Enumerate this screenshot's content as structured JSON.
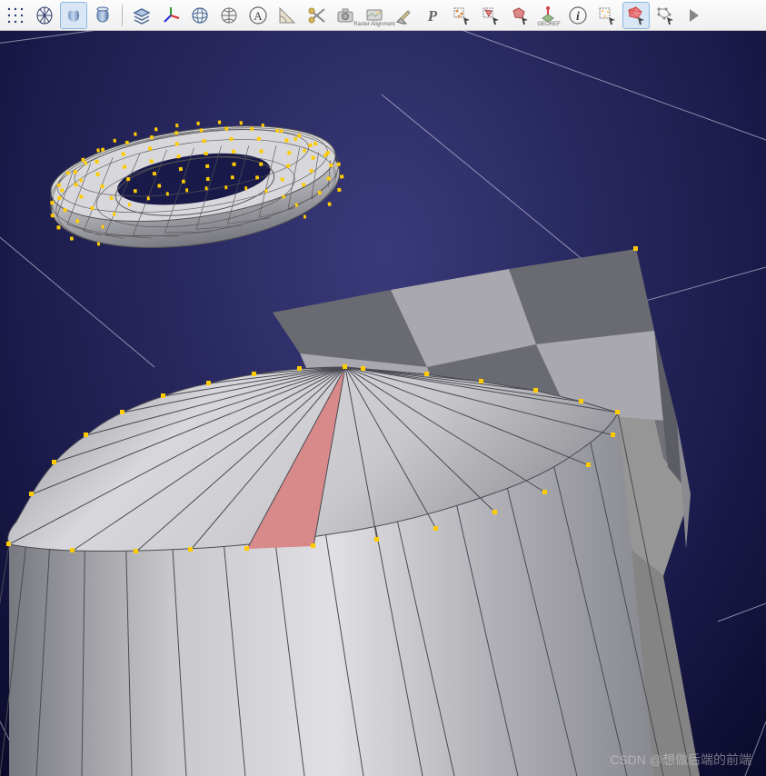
{
  "toolbar": {
    "groups": [
      {
        "name": "render-points-icon",
        "selected": false
      },
      {
        "name": "render-wireframe-icon",
        "selected": false
      },
      {
        "name": "render-flat-lines-icon",
        "selected": true
      },
      {
        "name": "render-flat-icon",
        "selected": false
      }
    ],
    "tools": [
      {
        "name": "layers-icon"
      },
      {
        "name": "axes-icon"
      },
      {
        "name": "trackball-icon"
      },
      {
        "name": "globe-icon"
      },
      {
        "name": "annotation-icon",
        "letter": "A"
      },
      {
        "name": "measure-angle-icon"
      },
      {
        "name": "scissors-icon"
      },
      {
        "name": "camera-snapshot-icon",
        "sublabel": ""
      },
      {
        "name": "raster-align-icon",
        "sublabel": "Raster Alignment"
      },
      {
        "name": "paint-icon"
      },
      {
        "name": "plugin-p-icon",
        "letter": "P"
      },
      {
        "name": "select-vertices-icon"
      },
      {
        "name": "select-faces-rect-icon"
      },
      {
        "name": "select-connected-icon"
      },
      {
        "name": "georef-icon",
        "sublabel": "GEOREF"
      },
      {
        "name": "info-icon",
        "letter": "i"
      },
      {
        "name": "select-region-icon"
      },
      {
        "name": "select-faces-icon",
        "selected": true
      },
      {
        "name": "select-nodes-icon"
      },
      {
        "name": "next-icon"
      }
    ]
  },
  "viewport": {
    "objects": [
      "torus-mesh",
      "cylinder-mesh",
      "box-mesh"
    ],
    "selected_face_color": "#d88a8a",
    "vertex_color": "#ffcc00",
    "edge_color": "#555555"
  },
  "watermark": "CSDN @想做后端的前端"
}
